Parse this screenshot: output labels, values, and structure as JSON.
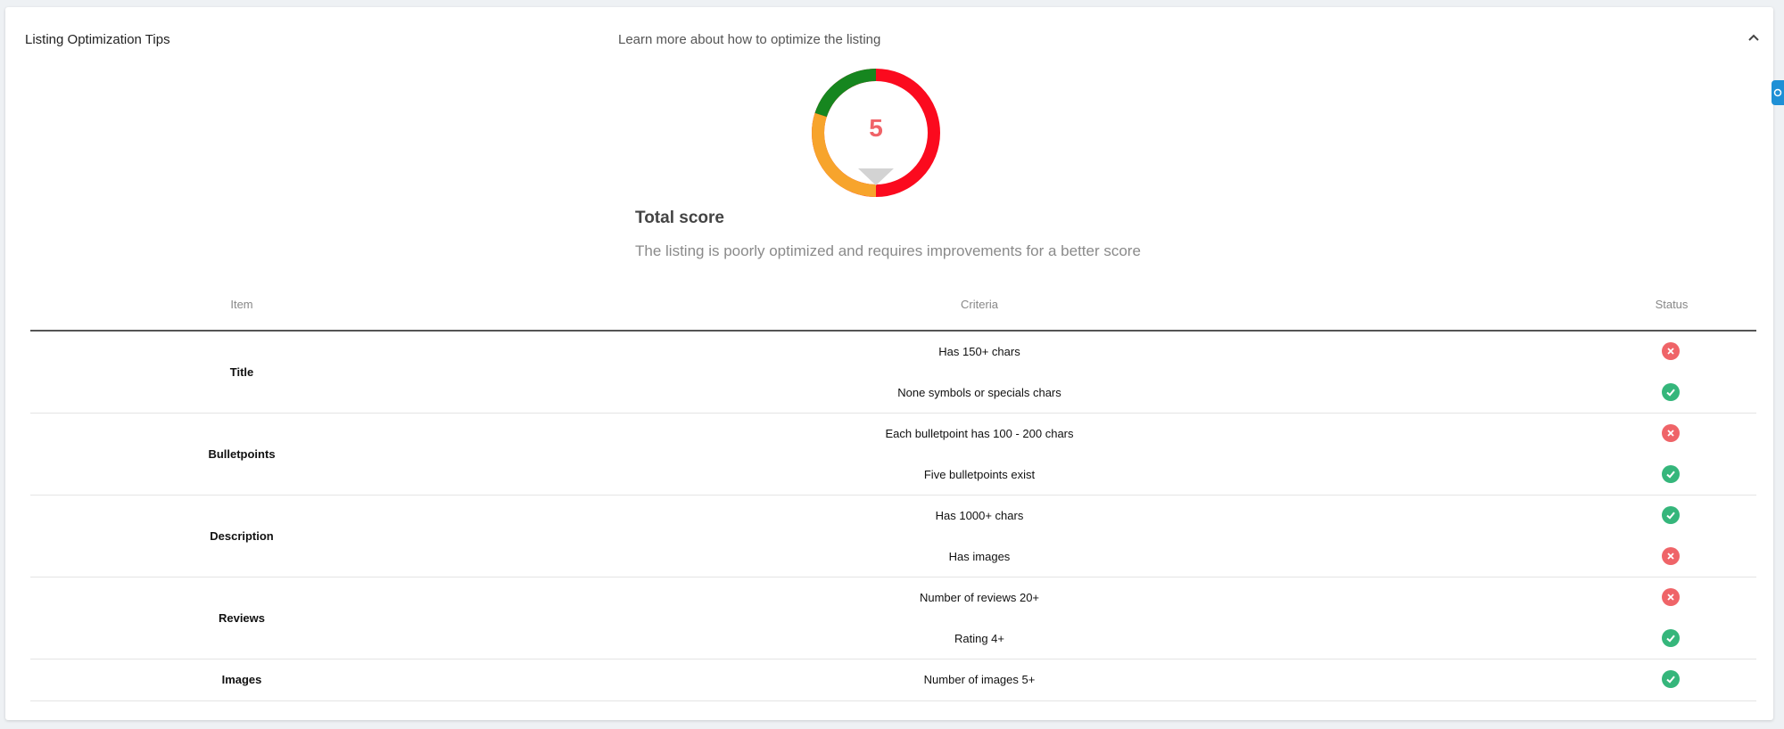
{
  "panel": {
    "title": "Listing Optimization Tips",
    "learn_more": "Learn more about how to optimize the listing",
    "collapse_icon": "chevron-up-icon"
  },
  "score": {
    "value": "5",
    "title": "Total score",
    "description": "The listing is poorly optimized and requires improvements for a better score",
    "colors": {
      "good": "#16861f",
      "medium": "#f7a42c",
      "bad": "#fb0a1e",
      "value_text": "#f06368"
    }
  },
  "table": {
    "headers": {
      "item": "Item",
      "criteria": "Criteria",
      "status": "Status"
    },
    "groups": [
      {
        "item": "Title",
        "criteria": [
          {
            "text": "Has 150+ chars",
            "status": "fail"
          },
          {
            "text": "None symbols or specials chars",
            "status": "pass"
          }
        ]
      },
      {
        "item": "Bulletpoints",
        "criteria": [
          {
            "text": "Each bulletpoint has 100 - 200 chars",
            "status": "fail"
          },
          {
            "text": "Five bulletpoints exist",
            "status": "pass"
          }
        ]
      },
      {
        "item": "Description",
        "criteria": [
          {
            "text": "Has 1000+ chars",
            "status": "pass"
          },
          {
            "text": "Has images",
            "status": "fail"
          }
        ]
      },
      {
        "item": "Reviews",
        "criteria": [
          {
            "text": "Number of reviews 20+",
            "status": "fail"
          },
          {
            "text": "Rating 4+",
            "status": "pass"
          }
        ]
      },
      {
        "item": "Images",
        "criteria": [
          {
            "text": "Number of images 5+",
            "status": "pass"
          }
        ]
      }
    ]
  }
}
